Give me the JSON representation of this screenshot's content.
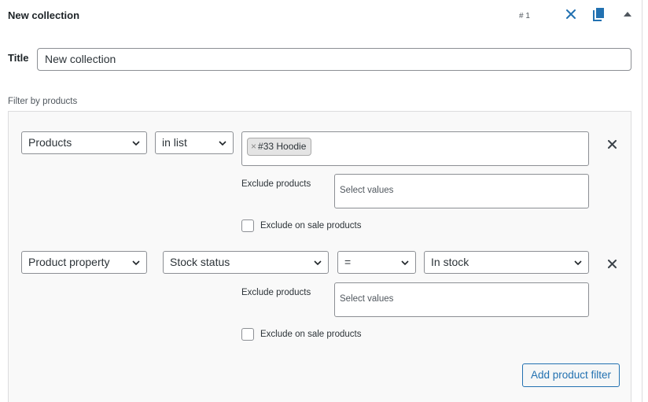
{
  "header": {
    "title": "New collection",
    "number": "# 1"
  },
  "title_field": {
    "label": "Title",
    "value": "New collection"
  },
  "filters_section": {
    "label": "Filter by products"
  },
  "filter1": {
    "type": "Products",
    "operator": "in list",
    "selected_chip": "#33 Hoodie",
    "exclude_label": "Exclude products",
    "exclude_placeholder": "Select values",
    "exclude_on_sale_label": "Exclude on sale products"
  },
  "filter2": {
    "type": "Product property",
    "property": "Stock status",
    "operator": "=",
    "value": "In stock",
    "exclude_label": "Exclude products",
    "exclude_placeholder": "Select values",
    "exclude_on_sale_label": "Exclude on sale products"
  },
  "actions": {
    "add_filter_label": "Add product filter"
  },
  "colors": {
    "accent": "#2271b1",
    "border": "#8c8f94",
    "text": "#1d2327"
  },
  "icons": {
    "close": "close-icon",
    "copy": "copy-icon",
    "collapse": "collapse-up-icon",
    "chevron": "chevron-down-icon",
    "remove": "remove-filter-icon"
  }
}
